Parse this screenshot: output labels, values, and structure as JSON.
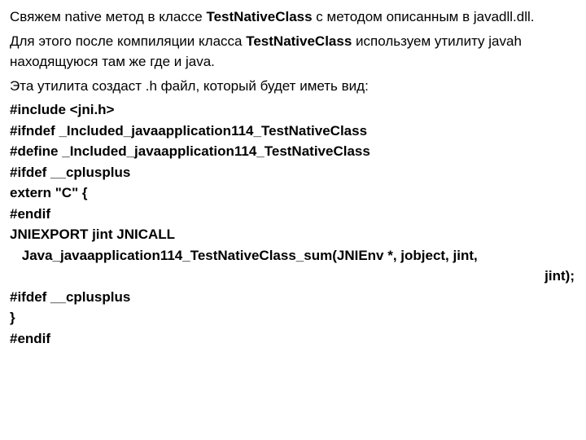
{
  "p1_a": "Свяжем native метод в классе ",
  "p1_b": "TestNativeClass",
  "p1_c": " с методом описанным в javadll.dll.",
  "p2_a": "Для этого после компиляции класса ",
  "p2_b": "TestNativeClass",
  "p2_c": " используем утилиту javah находящуюся там же где и java.",
  "p3": "Эта утилита создаст .h файл, который будет иметь вид:",
  "c1": "#include <jni.h>",
  "c2": "#ifndef _Included_javaapplication114_TestNativeClass",
  "c3": "#define _Included_javaapplication114_TestNativeClass",
  "c4": "#ifdef __cplusplus",
  "c5": "extern \"C\" {",
  "c6": "#endif",
  "c7": "JNIEXPORT jint JNICALL",
  "c8": " Java_javaapplication114_TestNativeClass_sum(JNIEnv *, jobject, jint,",
  "c8b": "jint);",
  "c9": "#ifdef __cplusplus",
  "c10": "}",
  "c11": "#endif"
}
